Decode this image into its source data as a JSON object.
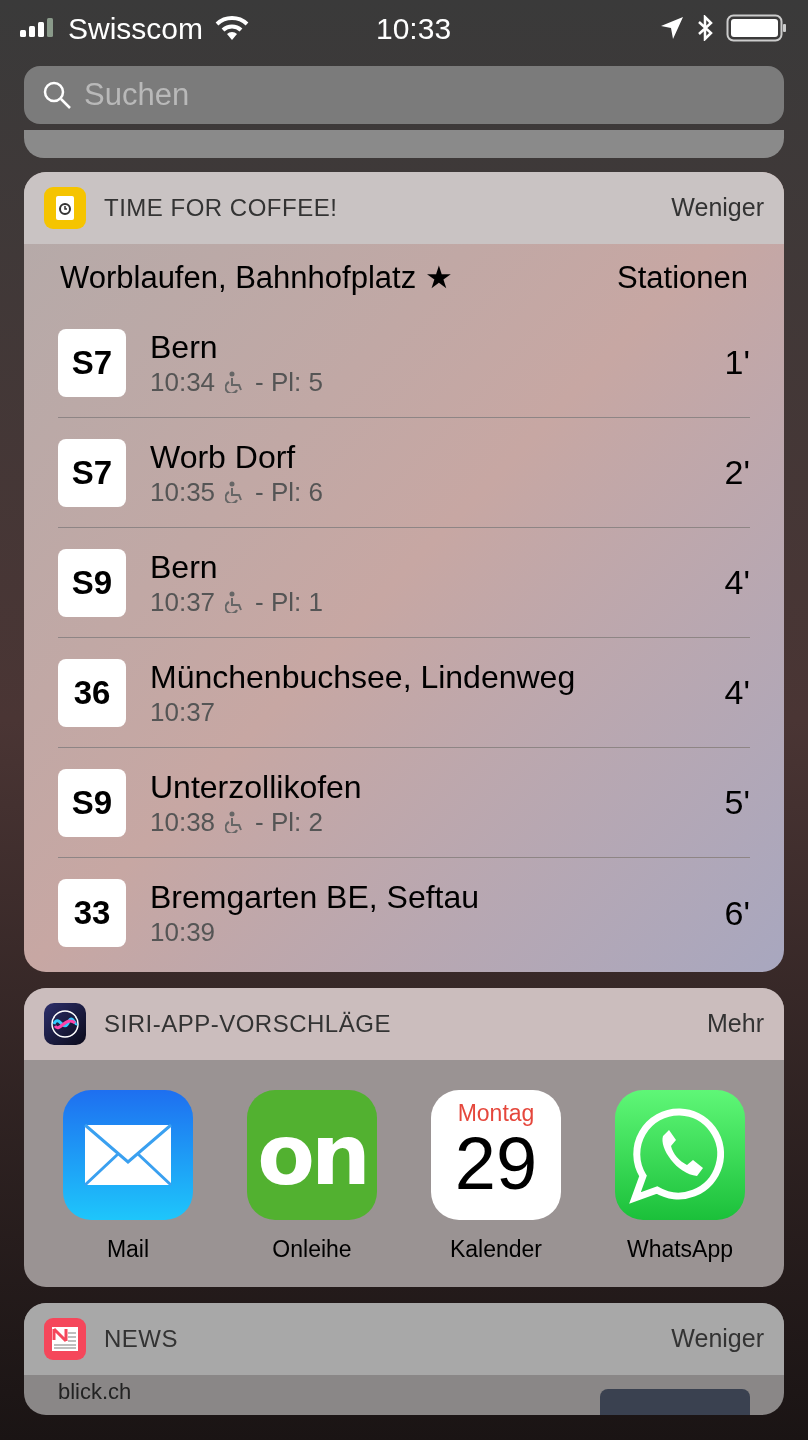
{
  "status_bar": {
    "carrier": "Swisscom",
    "time": "10:33"
  },
  "search": {
    "placeholder": "Suchen"
  },
  "widgets": [
    {
      "kind": "departures",
      "title": "TIME FOR COFFEE!",
      "action": "Weniger",
      "station": "Worblaufen, Bahnhofplatz ★",
      "stations_link": "Stationen",
      "rows": [
        {
          "line": "S7",
          "destination": "Bern",
          "time": "10:34",
          "accessible": true,
          "platform": "- Pl: 5",
          "minutes": "1'"
        },
        {
          "line": "S7",
          "destination": "Worb Dorf",
          "time": "10:35",
          "accessible": true,
          "platform": "- Pl: 6",
          "minutes": "2'"
        },
        {
          "line": "S9",
          "destination": "Bern",
          "time": "10:37",
          "accessible": true,
          "platform": "- Pl: 1",
          "minutes": "4'"
        },
        {
          "line": "36",
          "destination": "Münchenbuchsee, Lindenweg",
          "time": "10:37",
          "accessible": false,
          "minutes": "4'"
        },
        {
          "line": "S9",
          "destination": "Unterzollikofen",
          "time": "10:38",
          "accessible": true,
          "platform": "- Pl: 2",
          "minutes": "5'"
        },
        {
          "line": "33",
          "destination": "Bremgarten BE, Seftau",
          "time": "10:39",
          "accessible": false,
          "minutes": "6'"
        }
      ]
    },
    {
      "kind": "apps",
      "title": "SIRI-APP-VORSCHLÄGE",
      "action": "Mehr",
      "apps": [
        {
          "kind": "mail",
          "label": "Mail"
        },
        {
          "kind": "onleihe",
          "label": "Onleihe",
          "icon_text": "on"
        },
        {
          "kind": "calendar",
          "label": "Kalender",
          "weekday": "Montag",
          "day": "29"
        },
        {
          "kind": "whatsapp",
          "label": "WhatsApp"
        }
      ]
    },
    {
      "kind": "news",
      "title": "NEWS",
      "action": "Weniger",
      "source": "blick.ch"
    }
  ]
}
